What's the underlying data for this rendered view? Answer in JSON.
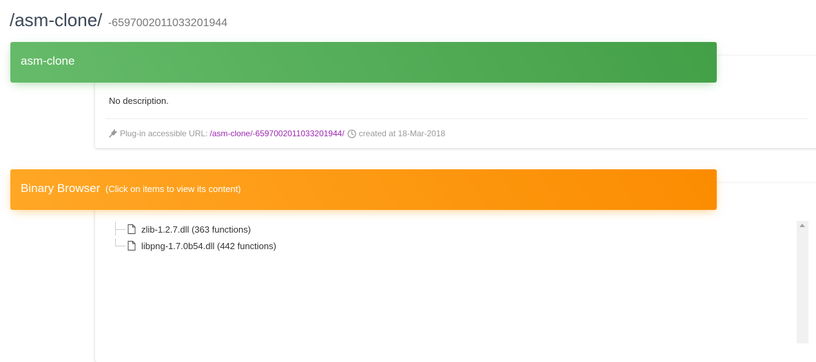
{
  "page": {
    "title": "/asm-clone/",
    "id": "-6597002011033201944"
  },
  "project_card": {
    "header": "asm-clone",
    "description": "No description.",
    "url_label": "Plug-in accessible URL:",
    "url": "/asm-clone/-6597002011033201944/",
    "created": "created at 18-Mar-2018",
    "icons": {
      "plug": "plug-icon",
      "clock": "clock-icon"
    },
    "colors": {
      "header_start": "#66bb6a",
      "header_end": "#43a047",
      "link": "#9c27b0"
    }
  },
  "binary_browser": {
    "title": "Binary Browser",
    "subtitle": "(Click on items to view its content)",
    "colors": {
      "header_start": "#ffa726",
      "header_end": "#fb8c00"
    },
    "items": [
      {
        "label": "zlib-1.2.7.dll (363 functions)",
        "icon": "file-icon"
      },
      {
        "label": "libpng-1.7.0b54.dll (442 functions)",
        "icon": "file-icon"
      }
    ]
  }
}
